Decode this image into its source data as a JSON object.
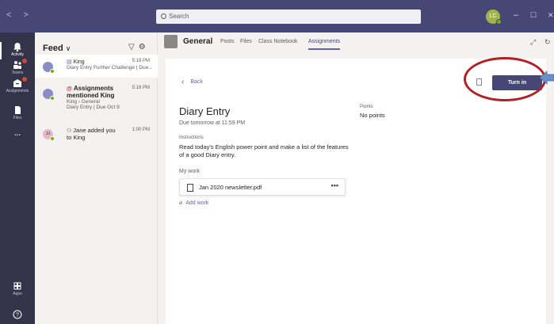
{
  "titlebar": {
    "nav_label": "< >",
    "search_placeholder": "Search",
    "user_initials": "LC",
    "win_min": "–",
    "win_max": "☐",
    "win_close": "✕"
  },
  "rail": [
    {
      "label": "Activity",
      "icon": "bell-icon",
      "active": true,
      "badge": false
    },
    {
      "label": "Teams",
      "icon": "teams-icon",
      "active": false,
      "badge": true
    },
    {
      "label": "Assignments",
      "icon": "assignments-icon",
      "active": false,
      "badge": true
    },
    {
      "label": "Files",
      "icon": "files-icon",
      "active": false,
      "badge": false
    },
    {
      "label": "...",
      "icon": "more-icon",
      "active": false,
      "badge": false
    },
    {
      "label": "Apps",
      "icon": "apps-icon",
      "active": false,
      "badge": false
    },
    {
      "label": "?",
      "icon": "help-icon",
      "active": false,
      "badge": false
    }
  ],
  "feed": {
    "title": "Feed",
    "chevron": "∨",
    "filter_icon": "filter-icon",
    "settings_icon": "gear-icon",
    "items": [
      {
        "line1": "King",
        "line2": "Diary Entry Further Challenge | Due...",
        "time": "5:19 PM"
      },
      {
        "line1": "Assignments",
        "line1b": "mentioned King",
        "line2": "King › General",
        "line3": "Diary Entry | Due Oct 9",
        "time": "5:18 PM"
      },
      {
        "line1": "Jane added you",
        "line1b": "to King",
        "time": "1:00 PM",
        "initials": "JJ"
      }
    ]
  },
  "channel": {
    "name": "General",
    "tabs": [
      "Posts",
      "Files",
      "Class Notebook",
      "Assignments"
    ],
    "active_tab": "Assignments",
    "expand_icon": "⤢",
    "refresh_icon": "↻"
  },
  "assignment": {
    "back_label": "Back",
    "turn_in_label": "Turn in",
    "title": "Diary Entry",
    "due": "Due tomorrow at 11:59 PM",
    "points_label": "Points",
    "points_value": "No points",
    "instructions_label": "Instructions",
    "instructions": "Read today's English power point and make a list of the features of a good Diary entry.",
    "my_work_label": "My work",
    "attachment": "Jan 2020 newsletter.pdf",
    "more": "•••",
    "add_work_label": "Add work"
  },
  "colors": {
    "titlebar": "#464775",
    "rail": "#33344a",
    "accent": "#6264a7",
    "annotation": "#b41f24",
    "arrow": "#6b8fc6"
  }
}
